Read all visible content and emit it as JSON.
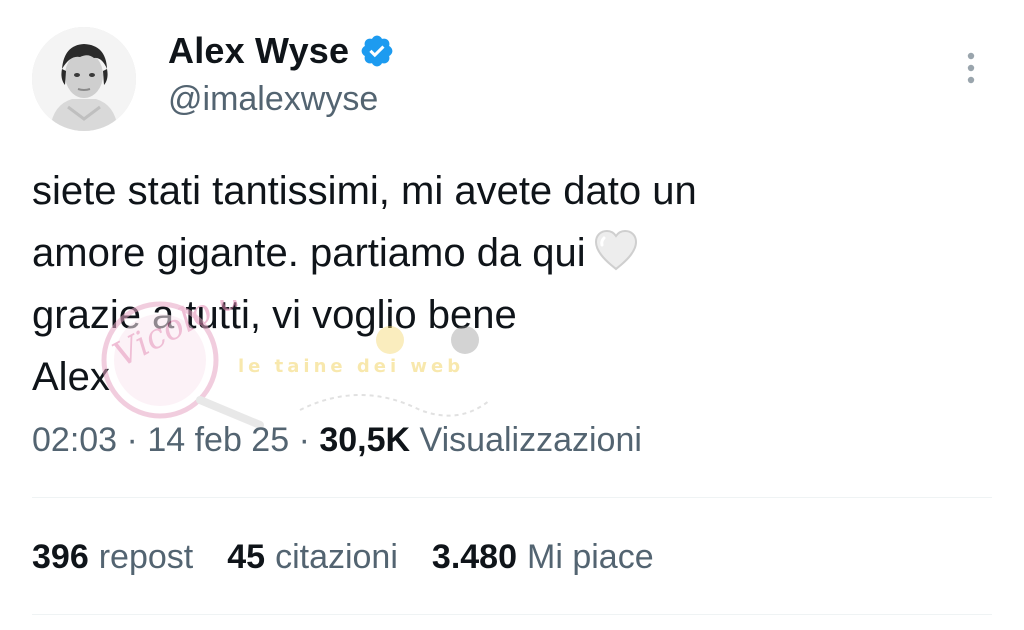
{
  "author": {
    "display_name": "Alex Wyse",
    "handle": "@imalexwyse",
    "verified_color": "#1d9bf0"
  },
  "tweet": {
    "lines": [
      "siete stati tantissimi, mi avete dato un",
      "amore gigante. partiamo da qui",
      "grazie a tutti, vi voglio bene",
      "Alex"
    ],
    "emoji": "white-heart"
  },
  "watermark": {
    "text": "Vicolo delle News",
    "subtext": "le taine dei web"
  },
  "meta": {
    "time": "02:03",
    "separator": "·",
    "date": "14 feb 25",
    "views_count": "30,5K",
    "views_label": "Visualizzazioni"
  },
  "stats": [
    {
      "count": "396",
      "label": "repost"
    },
    {
      "count": "45",
      "label": "citazioni"
    },
    {
      "count": "3.480",
      "label": "Mi piace"
    }
  ]
}
